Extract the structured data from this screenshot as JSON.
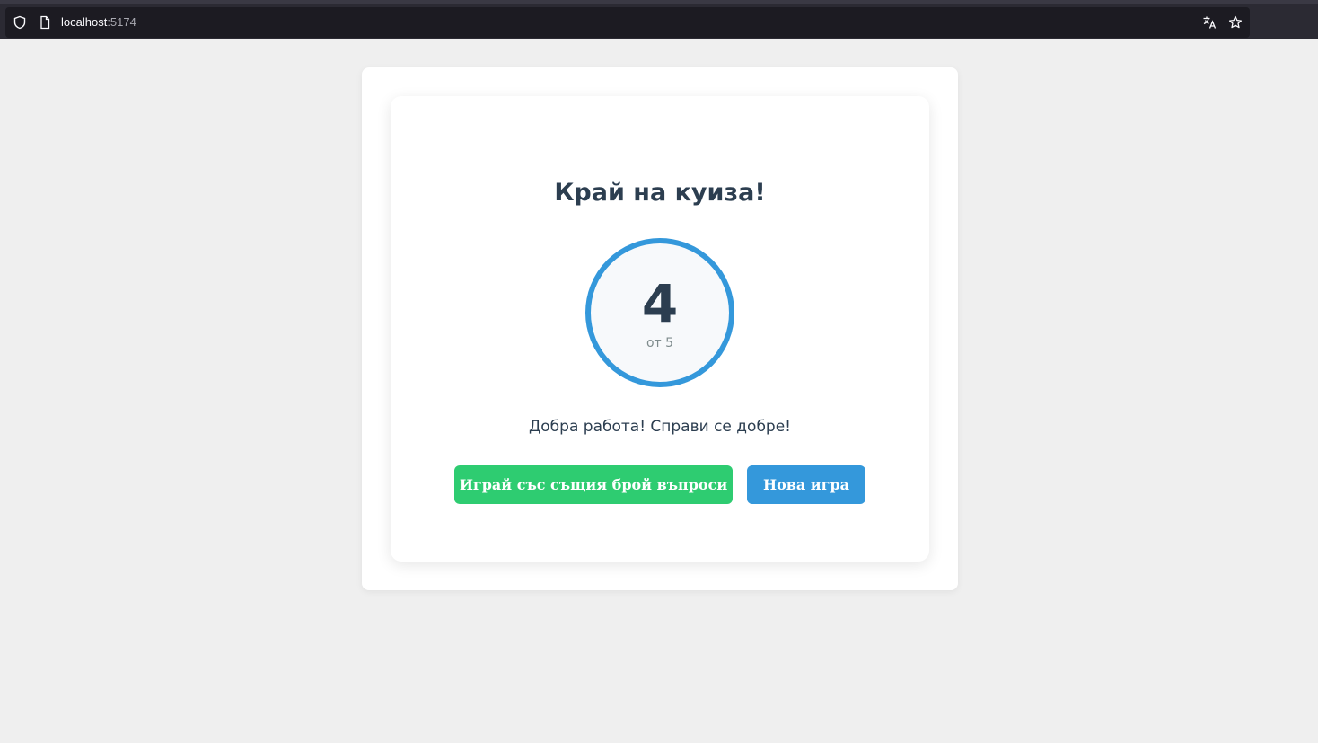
{
  "browser": {
    "url_host": "localhost",
    "url_port": ":5174",
    "icons": [
      "shield-icon",
      "page-icon",
      "translate-icon",
      "bookmark-star-icon"
    ]
  },
  "quiz_result": {
    "title": "Край на куиза!",
    "score": "4",
    "total_label": "от 5",
    "score_fraction": 0.8,
    "message": "Добра работа! Справи се добре!",
    "replay_button": "Играй със същия брой въпроси",
    "new_game_button": "Нова игра"
  },
  "colors": {
    "accent_blue": "#3498db",
    "accent_green": "#2ecc71",
    "text_dark": "#2c3e50",
    "text_muted": "#7f8c8d",
    "page_background": "#efefef"
  }
}
